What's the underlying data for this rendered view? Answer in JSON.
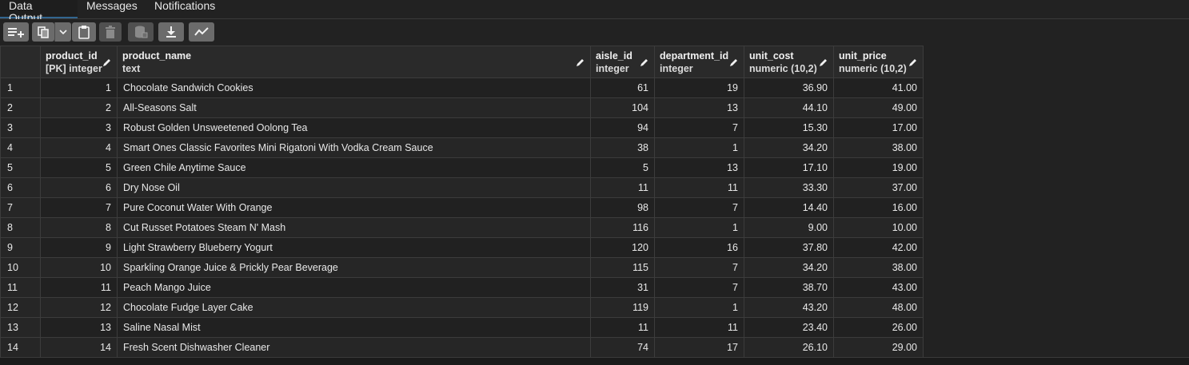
{
  "tabs": [
    "Data Output",
    "Messages",
    "Notifications"
  ],
  "toolbar": {
    "buttons": [
      "add-row-icon",
      "copy-icon",
      "chevron-down-icon",
      "paste-icon",
      "delete-icon",
      "save-data-icon",
      "download-icon",
      "graph-icon"
    ]
  },
  "columns": [
    {
      "name": "",
      "type": ""
    },
    {
      "name": "product_id",
      "type": "[PK] integer"
    },
    {
      "name": "product_name",
      "type": "text"
    },
    {
      "name": "aisle_id",
      "type": "integer"
    },
    {
      "name": "department_id",
      "type": "integer"
    },
    {
      "name": "unit_cost",
      "type": "numeric (10,2)"
    },
    {
      "name": "unit_price",
      "type": "numeric (10,2)"
    }
  ],
  "rows": [
    [
      "1",
      "1",
      "Chocolate Sandwich Cookies",
      "61",
      "19",
      "36.90",
      "41.00"
    ],
    [
      "2",
      "2",
      "All-Seasons Salt",
      "104",
      "13",
      "44.10",
      "49.00"
    ],
    [
      "3",
      "3",
      "Robust Golden Unsweetened Oolong Tea",
      "94",
      "7",
      "15.30",
      "17.00"
    ],
    [
      "4",
      "4",
      "Smart Ones Classic Favorites Mini Rigatoni With Vodka Cream Sauce",
      "38",
      "1",
      "34.20",
      "38.00"
    ],
    [
      "5",
      "5",
      "Green Chile Anytime Sauce",
      "5",
      "13",
      "17.10",
      "19.00"
    ],
    [
      "6",
      "6",
      "Dry Nose Oil",
      "11",
      "11",
      "33.30",
      "37.00"
    ],
    [
      "7",
      "7",
      "Pure Coconut Water With Orange",
      "98",
      "7",
      "14.40",
      "16.00"
    ],
    [
      "8",
      "8",
      "Cut Russet Potatoes Steam N' Mash",
      "116",
      "1",
      "9.00",
      "10.00"
    ],
    [
      "9",
      "9",
      "Light Strawberry Blueberry Yogurt",
      "120",
      "16",
      "37.80",
      "42.00"
    ],
    [
      "10",
      "10",
      "Sparkling Orange Juice & Prickly Pear Beverage",
      "115",
      "7",
      "34.20",
      "38.00"
    ],
    [
      "11",
      "11",
      "Peach Mango Juice",
      "31",
      "7",
      "38.70",
      "43.00"
    ],
    [
      "12",
      "12",
      "Chocolate Fudge Layer Cake",
      "119",
      "1",
      "43.20",
      "48.00"
    ],
    [
      "13",
      "13",
      "Saline Nasal Mist",
      "11",
      "11",
      "23.40",
      "26.00"
    ],
    [
      "14",
      "14",
      "Fresh Scent Dishwasher Cleaner",
      "74",
      "17",
      "26.10",
      "29.00"
    ]
  ],
  "colors": {
    "background": "#222222",
    "header": "#2a2a2a",
    "border": "#3c3c3c",
    "tab_underline": "#326690",
    "button": "#6b6b6b"
  }
}
